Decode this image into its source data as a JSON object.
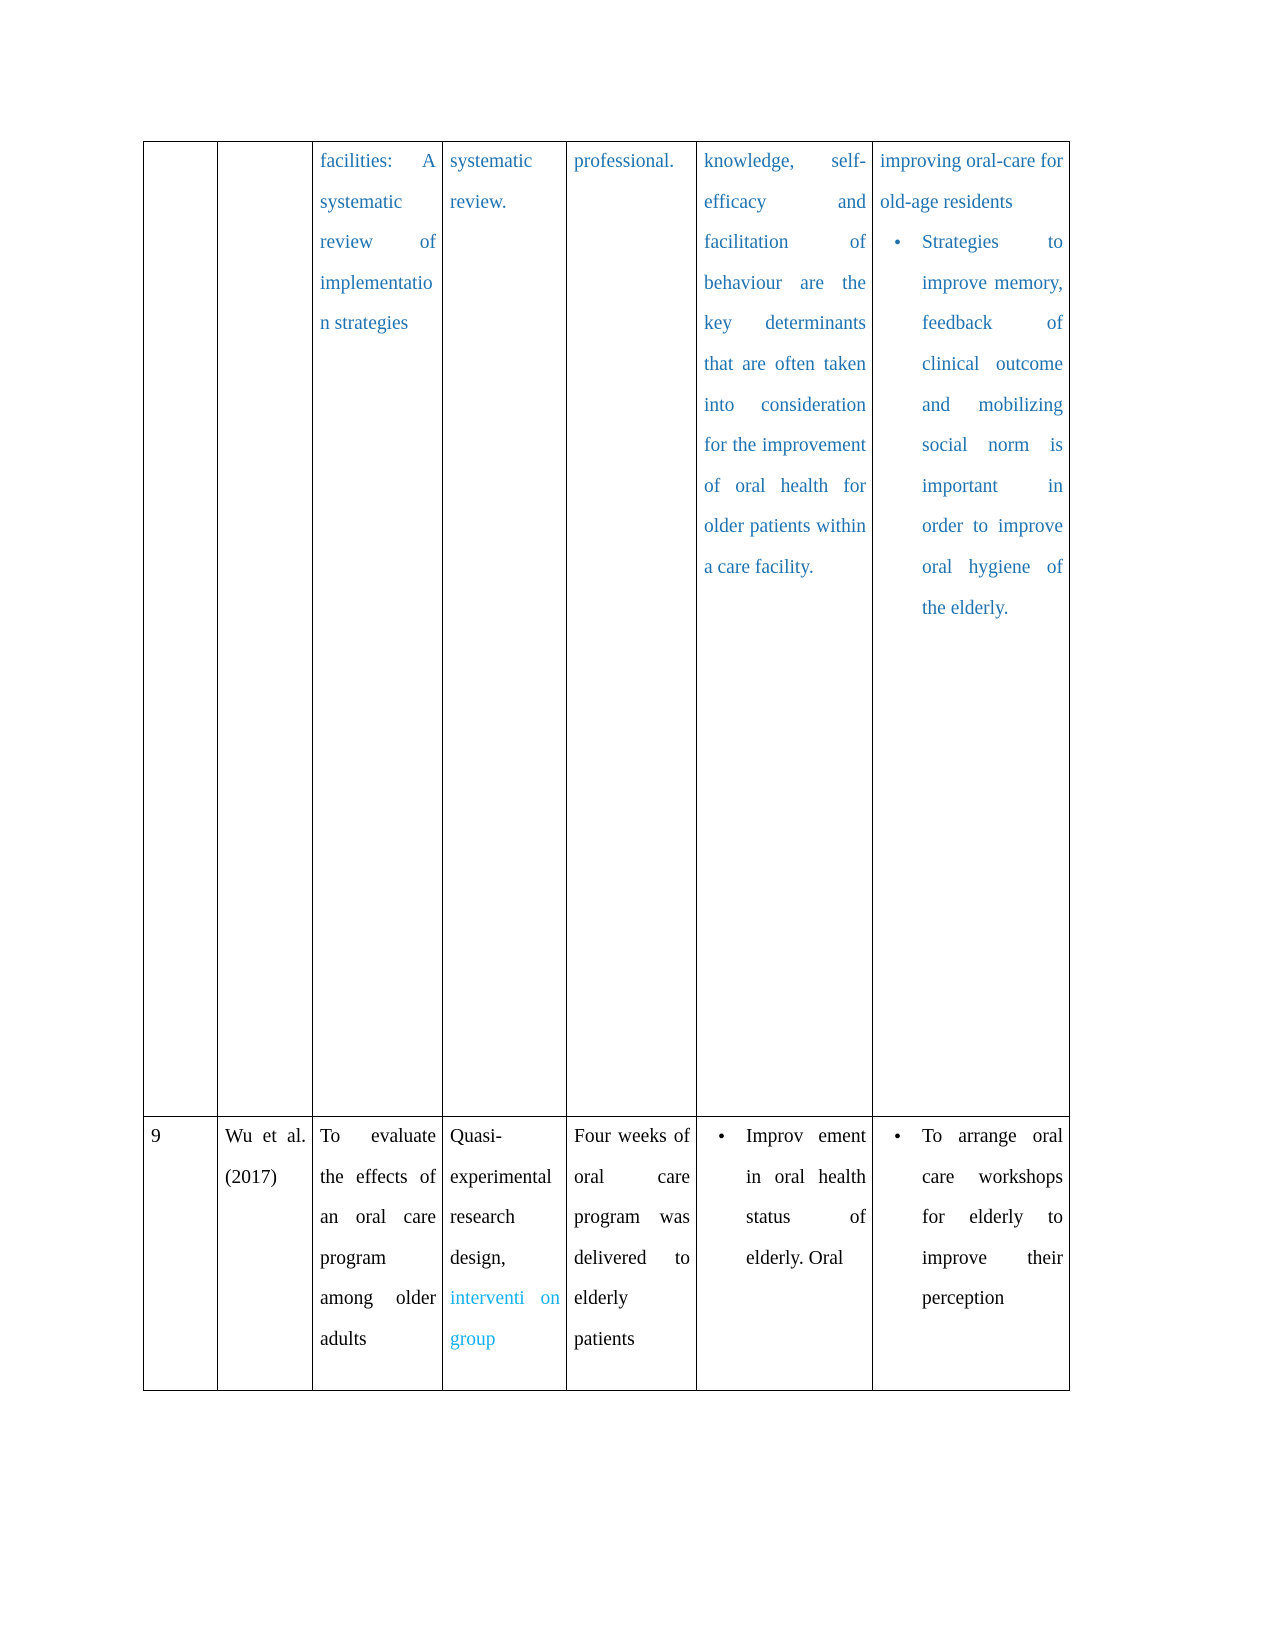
{
  "document": {
    "type": "literature-review-matrix-table",
    "text_colors": {
      "blue": "#1f72b0",
      "cyan": "#12b0ee",
      "black": "#000000"
    }
  },
  "table": {
    "columns": 7,
    "rows": [
      {
        "id": "row-continued",
        "continued_from_previous_page": true,
        "cells": {
          "no": "",
          "author_year": "",
          "objective": "facilities: A systematic review of implementation strategies",
          "design": "systematic review.",
          "intervention": "professional.",
          "findings": "knowledge, self-efficacy and facilitation of behaviour are the key determinants that are often taken into consideration for the improvement of oral health for older patients within a care facility.",
          "recommendations_intro": "improving oral-care for old-age residents",
          "recommendations_bullets": [
            "Strategies to improve memory, feedback of clinical outcome and mobilizing social norm is important in order to improve oral hygiene of the elderly."
          ]
        }
      },
      {
        "id": "row-9",
        "cells": {
          "no": "9",
          "author_year": "Wu et al. (2017)",
          "objective": "To evaluate the effects of an oral care program among older adults",
          "design_black_1": "Quasi-experimental research design,",
          "design_cyan_1": "interventi on group",
          "intervention": "Four weeks of oral care program was delivered to elderly patients",
          "findings_bullets": [
            "Improv ement in oral health status of elderly. Oral"
          ],
          "recommendations_bullets": [
            "To arrange oral care workshops for elderly to improve their perception"
          ]
        }
      }
    ]
  }
}
